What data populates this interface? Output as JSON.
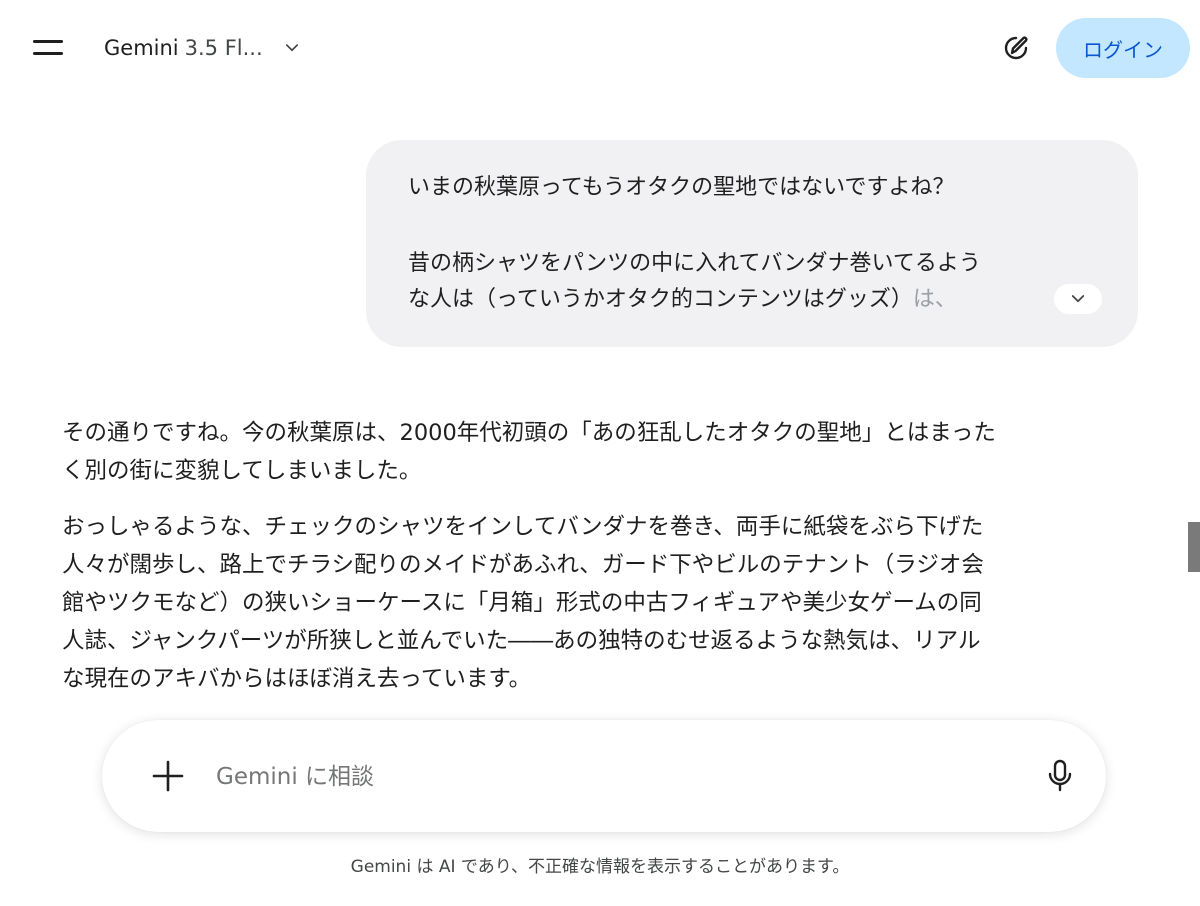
{
  "header": {
    "model_name": "Gemini",
    "model_version": "3.5 Fl...",
    "login_label": "ログイン",
    "menu_icon": "hamburger-menu-icon",
    "new_chat_icon": "edit-pencil-icon",
    "dropdown_icon": "chevron-down-icon"
  },
  "user_message": {
    "line1": "いまの秋葉原ってもうオタクの聖地ではないですよね？",
    "line2": "昔の柄シャツをパンツの中に入れてバンダナ巻いてるよう",
    "line3": "な人は（っていうかオタク的コンテンツはグッズ）",
    "line3_faded": "は、",
    "expand_icon": "chevron-down-icon"
  },
  "response": {
    "p1_line1": "その通りですね。今の秋葉原は、2000年代初頭の「あの狂乱したオタクの聖地」とはまった",
    "p1_line2": "く別の街に変貌してしまいました。",
    "p2_line1": "おっしゃるような、チェックのシャツをインしてバンダナを巻き、両手に紙袋をぶら下げた",
    "p2_line2": "人々が闊歩し、路上でチラシ配りのメイドがあふれ、ガード下やビルのテナント（ラジオ会",
    "p2_line3": "館やツクモなど）の狭いショーケースに「月箱」形式の中古フィギュアや美少女ゲームの同",
    "p2_line4": "人誌、ジャンクパーツが所狭しと並んでいた――あの独特のむせ返るような熱気は、リアル",
    "p2_line5": "な現在のアキバからはほぼ消え去っています。"
  },
  "composer": {
    "placeholder": "Gemini に相談",
    "add_icon": "plus-icon",
    "mic_icon": "microphone-icon"
  },
  "footer": {
    "disclaimer": "Gemini は AI であり、不正確な情報を表示することがあります。"
  },
  "colors": {
    "login_bg": "#c2e7ff",
    "login_text": "#0b57d0",
    "user_bubble_bg": "#f1f0f2",
    "text": "#1f1f1f"
  }
}
